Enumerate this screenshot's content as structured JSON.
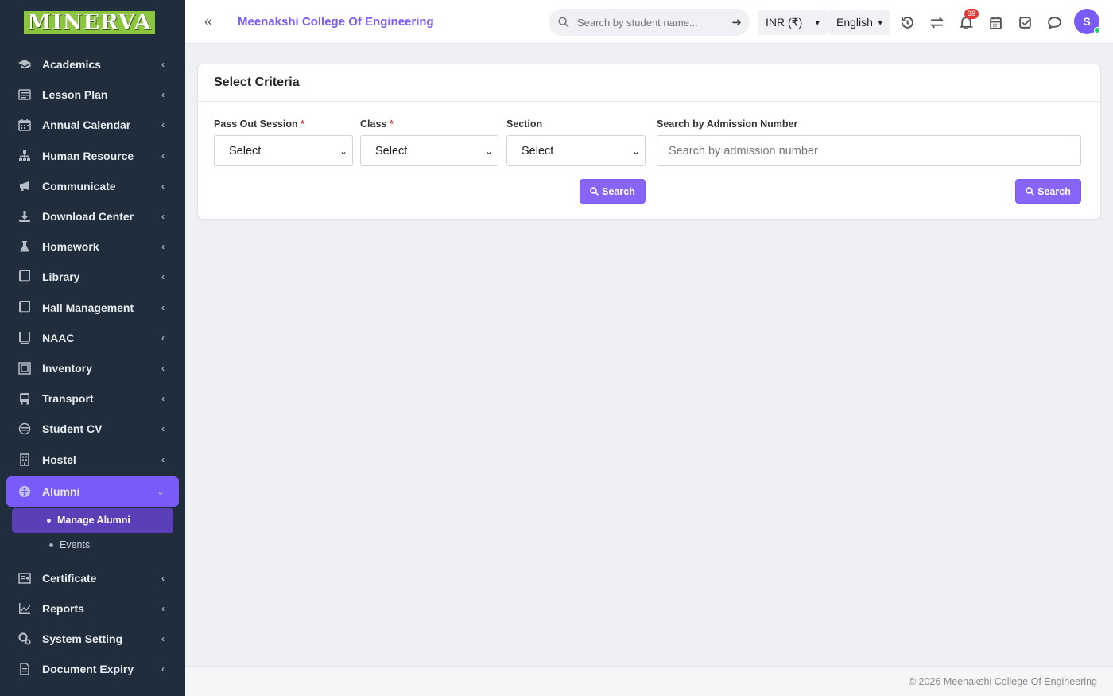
{
  "brand": {
    "logo_text": "MINERVA"
  },
  "sidebar": {
    "items": [
      {
        "label": "Academics",
        "icon": "graduation-cap-icon"
      },
      {
        "label": "Lesson Plan",
        "icon": "list-icon"
      },
      {
        "label": "Annual Calendar",
        "icon": "calendar-icon"
      },
      {
        "label": "Human Resource",
        "icon": "sitemap-icon"
      },
      {
        "label": "Communicate",
        "icon": "bullhorn-icon"
      },
      {
        "label": "Download Center",
        "icon": "download-icon"
      },
      {
        "label": "Homework",
        "icon": "flask-icon"
      },
      {
        "label": "Library",
        "icon": "book-icon"
      },
      {
        "label": "Hall Management",
        "icon": "book-icon"
      },
      {
        "label": "NAAC",
        "icon": "book-icon"
      },
      {
        "label": "Inventory",
        "icon": "boxes-icon"
      },
      {
        "label": "Transport",
        "icon": "bus-icon"
      },
      {
        "label": "Student CV",
        "icon": "cv-icon"
      },
      {
        "label": "Hostel",
        "icon": "building-icon"
      },
      {
        "label": "Alumni",
        "icon": "alumni-icon",
        "active": true
      },
      {
        "label": "Certificate",
        "icon": "certificate-icon"
      },
      {
        "label": "Reports",
        "icon": "chart-line-icon"
      },
      {
        "label": "System Setting",
        "icon": "cogs-icon"
      },
      {
        "label": "Document Expiry",
        "icon": "file-icon"
      }
    ],
    "alumni_sub": [
      {
        "label": "Manage Alumni",
        "active": true
      },
      {
        "label": "Events"
      }
    ]
  },
  "header": {
    "college": "Meenakshi College Of Engineering",
    "search_placeholder": "Search by student name...",
    "currency": "INR (₹)",
    "language": "English",
    "notification_count": "38",
    "avatar_initial": "S"
  },
  "criteria": {
    "title": "Select Criteria",
    "pass_out_session_label": "Pass Out Session",
    "class_label": "Class",
    "section_label": "Section",
    "admission_label": "Search by Admission Number",
    "select_placeholder": "Select",
    "admission_placeholder": "Search by admission number",
    "search_button": "Search",
    "required_mark": "*"
  },
  "footer": {
    "text": "© 2026 Meenakshi College Of Engineering"
  },
  "colors": {
    "accent": "#7a5af8",
    "sidebar_bg": "#1f2d3d",
    "logo_bg": "#8cc63f"
  }
}
